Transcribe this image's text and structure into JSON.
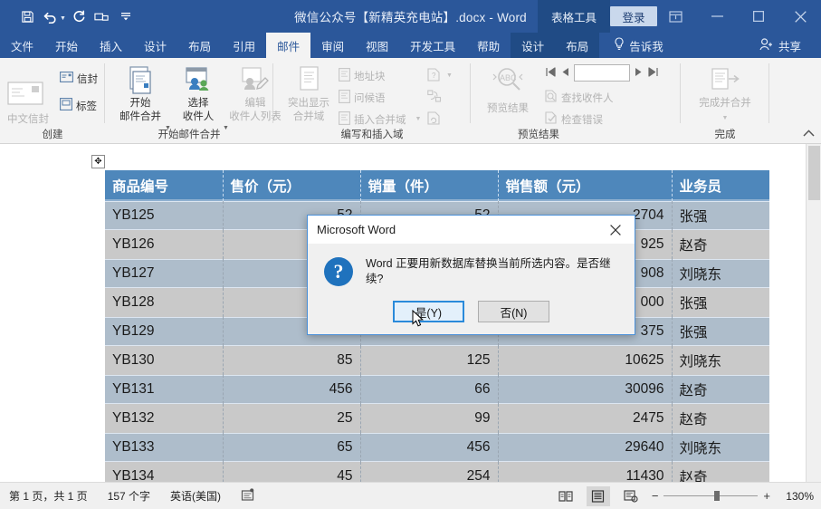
{
  "titlebar": {
    "document_title": "微信公众号【新精英充电站】.docx  -  Word",
    "table_tools_label": "表格工具",
    "signin_label": "登录",
    "quick_access": [
      {
        "name": "save-icon",
        "label": "保存"
      },
      {
        "name": "undo-icon",
        "label": "撤消"
      },
      {
        "name": "redo-icon",
        "label": "恢复"
      },
      {
        "name": "print-preview-icon",
        "label": "打印预览和打印"
      },
      {
        "name": "customize-qat-icon",
        "label": "自定义快速访问工具栏"
      }
    ],
    "window_buttons": [
      {
        "name": "ribbon-display-options-icon",
        "label": "功能区显示选项"
      },
      {
        "name": "minimize-icon",
        "label": "最小化"
      },
      {
        "name": "maximize-icon",
        "label": "最大化"
      },
      {
        "name": "close-icon",
        "label": "关闭"
      }
    ]
  },
  "ribbon_tabs": {
    "main": [
      "文件",
      "开始",
      "插入",
      "设计",
      "布局",
      "引用",
      "邮件",
      "审阅",
      "视图",
      "开发工具",
      "帮助"
    ],
    "active": "邮件",
    "contextual": [
      "设计",
      "布局"
    ],
    "tellme": "告诉我",
    "share": "共享"
  },
  "ribbon": {
    "groups": [
      {
        "label": "创建",
        "big": [],
        "small": [
          {
            "label": "中文信封",
            "disabled": true,
            "icon": "envelope-cn-icon"
          },
          {
            "label": "信封",
            "disabled": false,
            "icon": "envelope-icon"
          },
          {
            "label": "标签",
            "disabled": false,
            "icon": "label-icon"
          }
        ]
      },
      {
        "label": "开始邮件合并",
        "big": [
          {
            "label": "开始\n邮件合并",
            "line1": "开始",
            "line2": "邮件合并",
            "disabled": false,
            "dropdown": true,
            "icon": "start-mail-merge-icon"
          },
          {
            "label": "选择\n收件人",
            "line1": "选择",
            "line2": "收件人",
            "disabled": false,
            "dropdown": true,
            "icon": "select-recipients-icon"
          },
          {
            "label": "编辑\n收件人列表",
            "line1": "编辑",
            "line2": "收件人列表",
            "disabled": true,
            "dropdown": false,
            "icon": "edit-recipient-list-icon"
          }
        ],
        "small": []
      },
      {
        "label": "编写和插入域",
        "big": [
          {
            "line1": "突出显示",
            "line2": "合并域",
            "disabled": true,
            "dropdown": false,
            "icon": "highlight-merge-fields-icon"
          }
        ],
        "small": [
          {
            "label": "地址块",
            "disabled": true,
            "icon": "address-block-icon"
          },
          {
            "label": "问候语",
            "disabled": true,
            "icon": "greeting-line-icon"
          },
          {
            "label": "插入合并域",
            "disabled": true,
            "icon": "insert-merge-field-icon",
            "dropdown": true
          },
          {
            "label": "",
            "disabled": true,
            "icon": "rules-icon",
            "dropdown": true
          },
          {
            "label": "",
            "disabled": true,
            "icon": "match-fields-icon"
          },
          {
            "label": "",
            "disabled": true,
            "icon": "update-labels-icon"
          }
        ]
      },
      {
        "label": "预览结果",
        "big": [
          {
            "line1": "预览结果",
            "line2": "",
            "disabled": true,
            "dropdown": false,
            "icon": "preview-results-icon"
          }
        ],
        "small": [
          {
            "label": "查找收件人",
            "disabled": true,
            "icon": "find-recipient-icon"
          },
          {
            "label": "检查错误",
            "disabled": true,
            "icon": "check-errors-icon"
          }
        ],
        "record_nav": {
          "value": "",
          "first": "首记录",
          "prev": "上一记录",
          "next": "下一记录",
          "last": "尾记录"
        }
      },
      {
        "label": "完成",
        "big": [
          {
            "line1": "完成并合并",
            "line2": "",
            "disabled": true,
            "dropdown": true,
            "icon": "finish-and-merge-icon"
          }
        ],
        "small": []
      }
    ],
    "collapse_label": "折叠功能区"
  },
  "table": {
    "headers": [
      "商品编号",
      "售价（元）",
      "销量（件）",
      "销售额（元）",
      "业务员"
    ],
    "rows": [
      {
        "id": "YB125",
        "price": "52",
        "qty": "52",
        "amount": "2704",
        "sales": "张强"
      },
      {
        "id": "YB126",
        "price": "",
        "qty": "",
        "amount": "925",
        "sales": "赵奇"
      },
      {
        "id": "YB127",
        "price": "",
        "qty": "",
        "amount": "908",
        "sales": "刘晓东"
      },
      {
        "id": "YB128",
        "price": "",
        "qty": "",
        "amount": "000",
        "sales": "张强"
      },
      {
        "id": "YB129",
        "price": "",
        "qty": "",
        "amount": "375",
        "sales": "张强"
      },
      {
        "id": "YB130",
        "price": "85",
        "qty": "125",
        "amount": "10625",
        "sales": "刘晓东"
      },
      {
        "id": "YB131",
        "price": "456",
        "qty": "66",
        "amount": "30096",
        "sales": "赵奇"
      },
      {
        "id": "YB132",
        "price": "25",
        "qty": "99",
        "amount": "2475",
        "sales": "赵奇"
      },
      {
        "id": "YB133",
        "price": "65",
        "qty": "456",
        "amount": "29640",
        "sales": "刘晓东"
      },
      {
        "id": "YB134",
        "price": "45",
        "qty": "254",
        "amount": "11430",
        "sales": "赵奇"
      }
    ]
  },
  "dialog": {
    "title": "Microsoft Word",
    "close_label": "×",
    "icon": "question-icon",
    "icon_glyph": "?",
    "message": "Word 正要用新数据库替换当前所选内容。是否继续?",
    "yes_label": "是(Y)",
    "no_label": "否(N)"
  },
  "statusbar": {
    "page_info": "第 1 页，共 1 页",
    "word_count": "157 个字",
    "language": "英语(美国)",
    "proofing_icon": "proofing-errors-icon",
    "views": [
      {
        "name": "read-mode-icon",
        "label": "阅读视图",
        "selected": false
      },
      {
        "name": "print-layout-icon",
        "label": "页面视图",
        "selected": true
      },
      {
        "name": "web-layout-icon",
        "label": "Web 版式视图",
        "selected": false
      }
    ],
    "zoom_out": "−",
    "zoom_in": "+",
    "zoom_level": "130%"
  },
  "colors": {
    "word_blue": "#2b579a",
    "contextual_blue": "#204b85",
    "table_header": "#4e87bb",
    "row_selected": "#aebdcb",
    "row_alt": "#c9c9c9",
    "dialog_accent": "#2a8ada",
    "question_icon": "#1f72bd"
  }
}
